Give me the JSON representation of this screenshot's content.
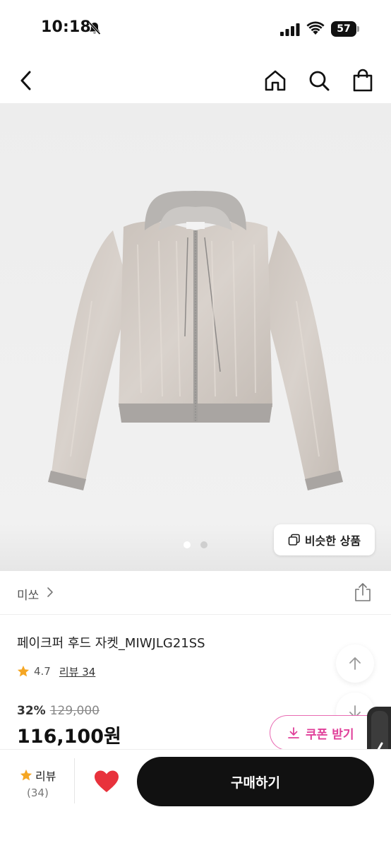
{
  "status_bar": {
    "time": "10:18",
    "battery": "57",
    "icons": [
      "bell-slash-icon",
      "signal-icon",
      "wifi-icon",
      "battery-icon"
    ]
  },
  "nav": {
    "icons": [
      "back-chevron-icon",
      "home-icon",
      "search-icon",
      "shopping-bag-icon"
    ]
  },
  "gallery": {
    "current_page": 1,
    "total_pages": 2,
    "similar_products_label": "비슷한 상품",
    "active_dot_color": "#ffffff",
    "inactive_dot_color": "#cfcfcf"
  },
  "product": {
    "brand": "미쏘",
    "title": "페이크퍼 후드 자켓_MIWJLG21SS",
    "rating": "4.7",
    "review_link": "리뷰 34",
    "discount": "32%",
    "original_price": "129,000",
    "price": "116,100원",
    "coupon_label": "쿠폰 받기"
  },
  "bottom_bar": {
    "review_label": "리뷰",
    "review_count": "(34)",
    "buy_label": "구매하기"
  },
  "colors": {
    "star": "#f5a623",
    "heart": "#e8323c",
    "coupon": "#e0409a",
    "buy_button": "#111111"
  }
}
